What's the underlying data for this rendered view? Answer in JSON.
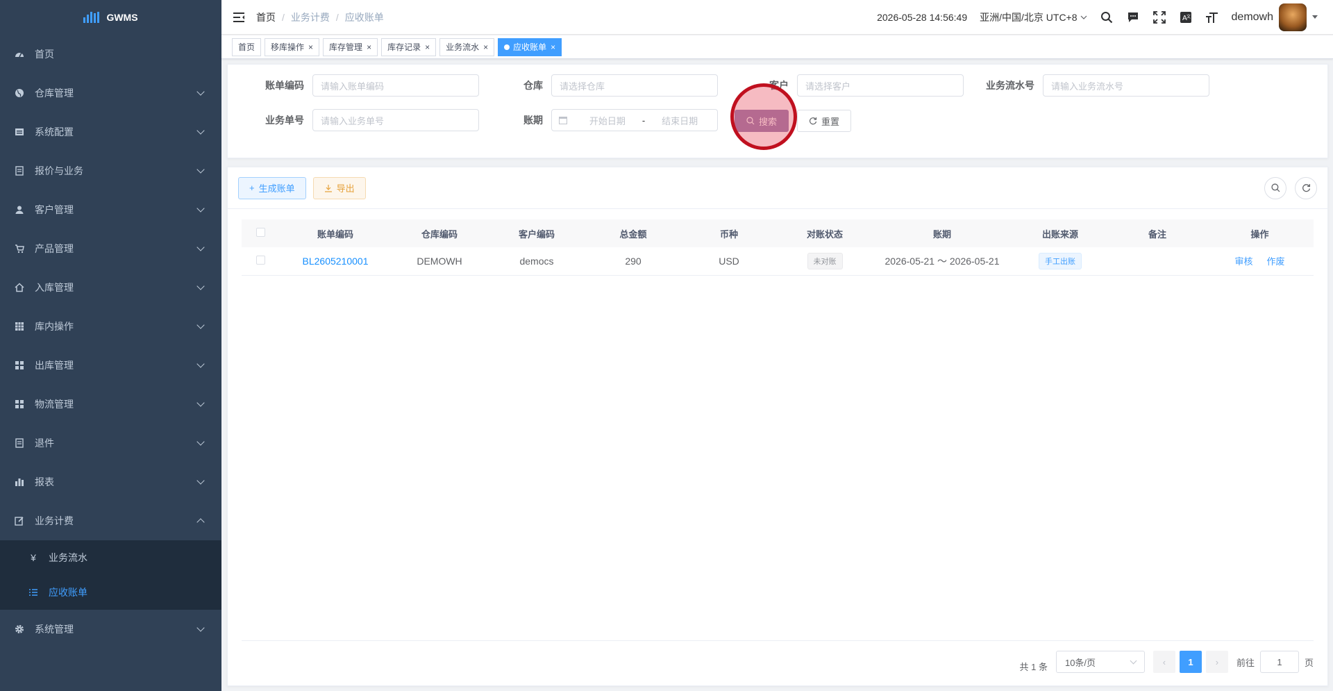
{
  "app": {
    "logo_text": "GWMS"
  },
  "sidebar": {
    "items": [
      {
        "label": "首页"
      },
      {
        "label": "仓库管理"
      },
      {
        "label": "系统配置"
      },
      {
        "label": "报价与业务"
      },
      {
        "label": "客户管理"
      },
      {
        "label": "产品管理"
      },
      {
        "label": "入库管理"
      },
      {
        "label": "库内操作"
      },
      {
        "label": "出库管理"
      },
      {
        "label": "物流管理"
      },
      {
        "label": "退件"
      },
      {
        "label": "报表"
      },
      {
        "label": "业务计费"
      },
      {
        "label": "系统管理"
      }
    ],
    "submenu": [
      {
        "label": "业务流水",
        "icon": "¥"
      },
      {
        "label": "应收账单"
      }
    ]
  },
  "navbar": {
    "breadcrumb": [
      "首页",
      "业务计费",
      "应收账单"
    ],
    "datetime": "2026-05-28 14:56:49",
    "timezone": "亚洲/中国/北京 UTC+8",
    "username": "demowh"
  },
  "tags": [
    "首页",
    "移库操作",
    "库存管理",
    "库存记录",
    "业务流水",
    "应收账单"
  ],
  "search": {
    "bill_code": {
      "label": "账单编码",
      "placeholder": "请输入账单编码"
    },
    "warehouse": {
      "label": "仓库",
      "placeholder": "请选择仓库"
    },
    "customer": {
      "label": "客户",
      "placeholder": "请选择客户"
    },
    "flow_no": {
      "label": "业务流水号",
      "placeholder": "请输入业务流水号"
    },
    "biz_no": {
      "label": "业务单号",
      "placeholder": "请输入业务单号"
    },
    "period": {
      "label": "账期",
      "start_placeholder": "开始日期",
      "separator": "-",
      "end_placeholder": "结束日期"
    },
    "search_btn": "搜索",
    "reset_btn": "重置"
  },
  "toolbar": {
    "generate_btn": "生成账单",
    "export_btn": "导出"
  },
  "table": {
    "columns": [
      "账单编码",
      "仓库编码",
      "客户编码",
      "总金额",
      "币种",
      "对账状态",
      "账期",
      "出账来源",
      "备注",
      "操作"
    ],
    "rows": [
      {
        "bill_code": "BL2605210001",
        "warehouse_code": "DEMOWH",
        "customer_code": "democs",
        "total": "290",
        "currency": "USD",
        "status": "未对账",
        "period": "2026-05-21 ～ 2026-05-21",
        "source": "手工出账",
        "remark": "",
        "actions": [
          "审核",
          "作废"
        ]
      }
    ]
  },
  "pagination": {
    "total_text": "共 1 条",
    "page_size": "10条/页",
    "current_page": "1",
    "goto_label": "前往",
    "goto_value": "1",
    "page_suffix": "页"
  },
  "colors": {
    "primary": "#409eff",
    "sidebar_bg": "#304156",
    "submenu_bg": "#1f2d3d",
    "click_marker": "#c0101f"
  }
}
